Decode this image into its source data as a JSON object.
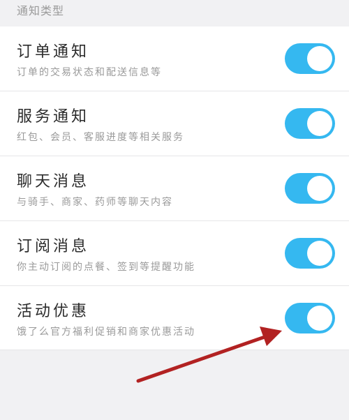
{
  "section": {
    "title": "通知类型"
  },
  "settings": [
    {
      "title": "订单通知",
      "description": "订单的交易状态和配送信息等",
      "enabled": true
    },
    {
      "title": "服务通知",
      "description": "红包、会员、客服进度等相关服务",
      "enabled": true
    },
    {
      "title": "聊天消息",
      "description": "与骑手、商家、药师等聊天内容",
      "enabled": true
    },
    {
      "title": "订阅消息",
      "description": "你主动订阅的点餐、签到等提醒功能",
      "enabled": true
    },
    {
      "title": "活动优惠",
      "description": "饿了么官方福利促销和商家优惠活动",
      "enabled": true
    }
  ],
  "colors": {
    "toggle_on": "#35b8f0",
    "annotation_arrow": "#b22222"
  }
}
